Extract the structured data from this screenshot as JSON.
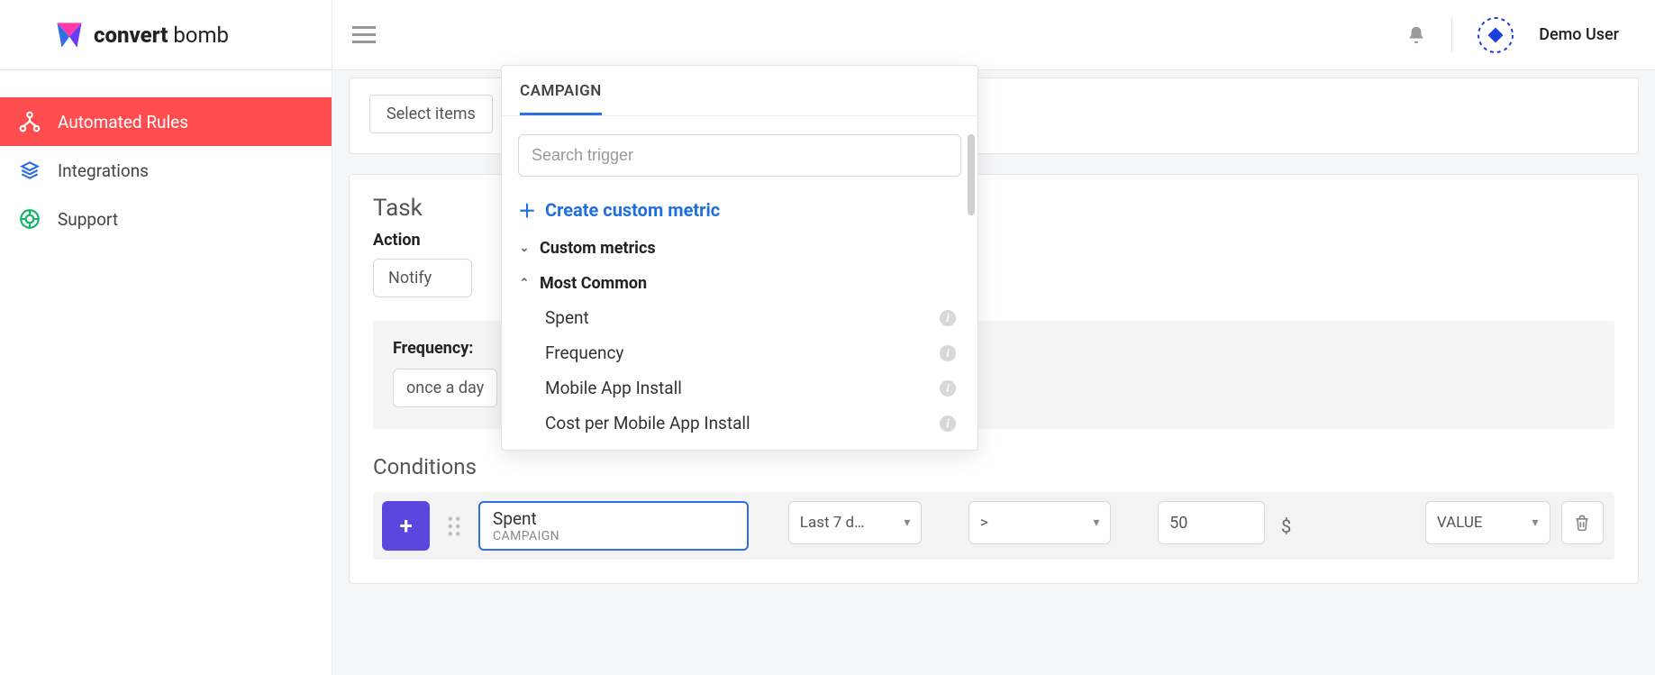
{
  "brand": {
    "bold": "convert",
    "light": " bomb"
  },
  "user": {
    "name": "Demo User"
  },
  "sidebar": {
    "items": [
      {
        "label": "Automated Rules"
      },
      {
        "label": "Integrations"
      },
      {
        "label": "Support"
      }
    ]
  },
  "top_card": {
    "select_items_label": "Select items"
  },
  "task": {
    "title": "Task",
    "action_label": "Action",
    "action_value": "Notify",
    "frequency_label": "Frequency:",
    "frequency_value": "once a day"
  },
  "conditions": {
    "title": "Conditions",
    "row": {
      "metric_name": "Spent",
      "metric_scope": "CAMPAIGN",
      "date_range": "Last 7 d…",
      "operator": ">",
      "value": "50",
      "unit": "$",
      "value_type": "VALUE"
    }
  },
  "popover": {
    "tab": "CAMPAIGN",
    "search_placeholder": "Search trigger",
    "create_label": "Create custom metric",
    "groups": {
      "custom": "Custom metrics",
      "common": "Most Common"
    },
    "metrics": [
      "Spent",
      "Frequency",
      "Mobile App Install",
      "Cost per Mobile App Install"
    ]
  }
}
